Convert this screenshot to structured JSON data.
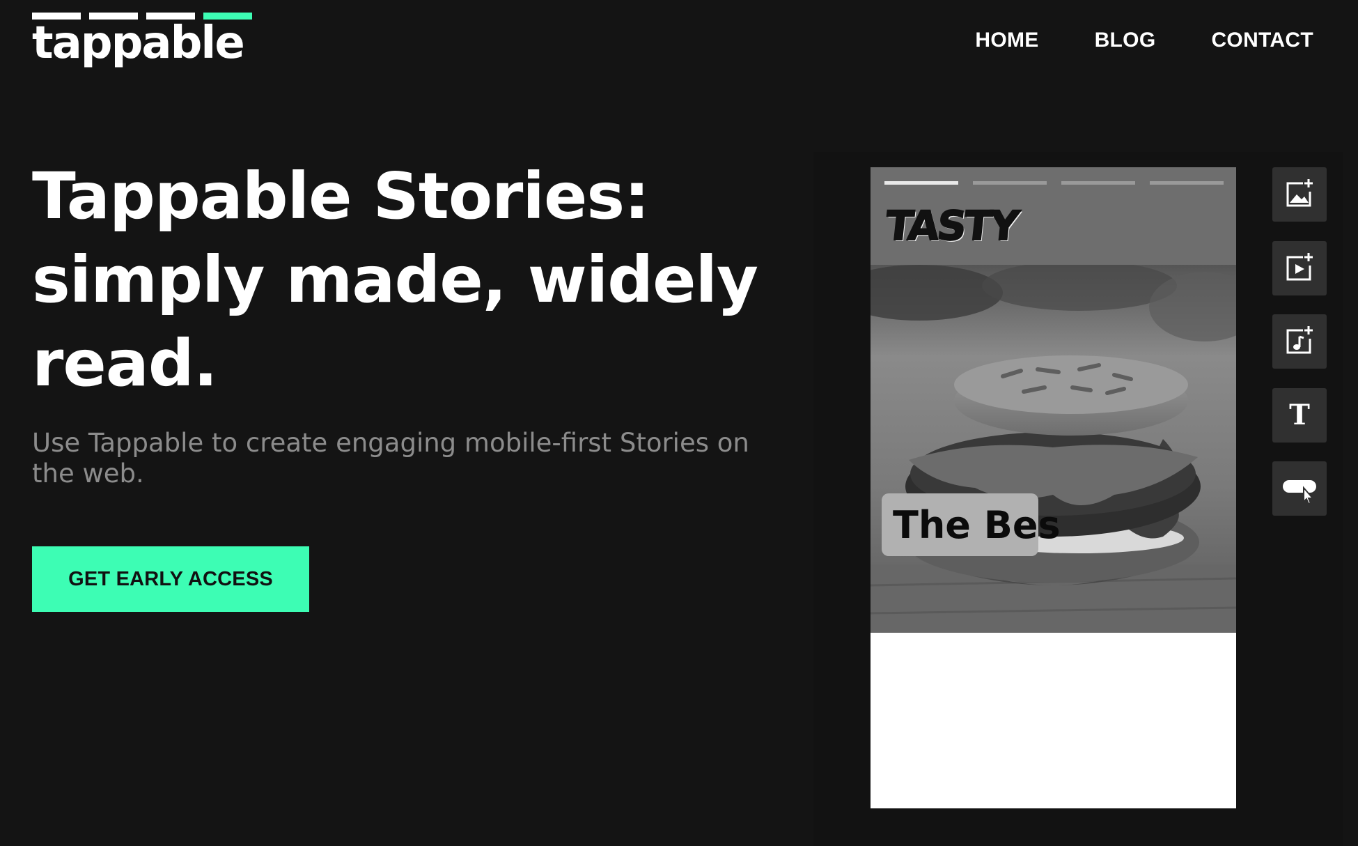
{
  "brand": {
    "logo_text": "tappable",
    "bar_colors": [
      "#ffffff",
      "#ffffff",
      "#ffffff",
      "#3dfdb4"
    ]
  },
  "nav": {
    "items": [
      {
        "label": "HOME"
      },
      {
        "label": "BLOG"
      },
      {
        "label": "CONTACT"
      }
    ]
  },
  "hero": {
    "headline": "Tappable Stories: simply made, widely read.",
    "subheadline": "Use Tappable to create engaging mobile-first Stories on the web.",
    "cta_label": "GET EARLY ACCESS"
  },
  "story_preview": {
    "brand_text": "TASTY",
    "caption_text": "The Bes",
    "progress": [
      1,
      0,
      0,
      0
    ],
    "image_subject": "burger"
  },
  "tools": [
    {
      "icon": "add-image-icon"
    },
    {
      "icon": "add-video-icon"
    },
    {
      "icon": "add-audio-icon"
    },
    {
      "icon": "text-icon",
      "glyph": "T"
    },
    {
      "icon": "button-cursor-icon"
    }
  ],
  "colors": {
    "background": "#141414",
    "accent": "#3dfdb4",
    "subtext": "#8c8c8c",
    "tool_button": "#303030"
  }
}
